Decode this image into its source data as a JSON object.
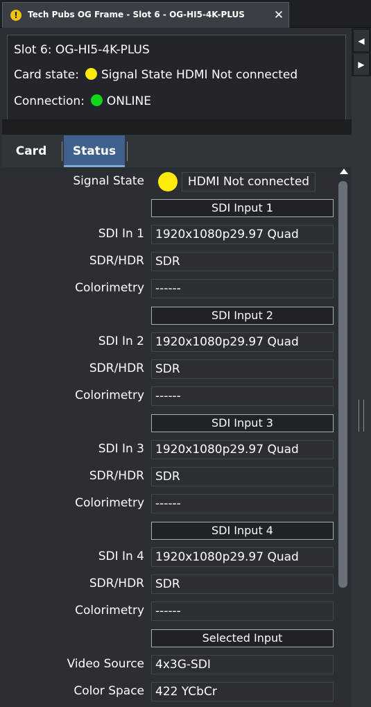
{
  "window": {
    "tab_title": "Tech Pubs OG Frame - Slot 6 - OG-HI5-4K-PLUS",
    "warn_icon_glyph": "!",
    "close_glyph": "✕"
  },
  "side": {
    "left_glyph": "◀",
    "right_glyph": "▶"
  },
  "info": {
    "title": "Slot 6: OG-HI5-4K-PLUS",
    "card_state_label": "Card state:",
    "card_state_value": "Signal State HDMI Not connected",
    "card_state_color": "#ffeb0a",
    "connection_label": "Connection:",
    "connection_value": "ONLINE",
    "connection_color": "#12d61a"
  },
  "tabs": [
    {
      "label": "Card",
      "active": false
    },
    {
      "label": "Status",
      "active": true
    }
  ],
  "status": {
    "signal_state": {
      "label": "Signal State",
      "value": "HDMI Not connected",
      "color": "#ffeb0a"
    },
    "sections": [
      {
        "header": "SDI Input 1",
        "rows": [
          {
            "label": "SDI In 1",
            "value": "1920x1080p29.97 Quad"
          },
          {
            "label": "SDR/HDR",
            "value": "SDR"
          },
          {
            "label": "Colorimetry",
            "value": "------"
          }
        ]
      },
      {
        "header": "SDI Input 2",
        "rows": [
          {
            "label": "SDI In 2",
            "value": "1920x1080p29.97 Quad"
          },
          {
            "label": "SDR/HDR",
            "value": "SDR"
          },
          {
            "label": "Colorimetry",
            "value": "------"
          }
        ]
      },
      {
        "header": "SDI Input 3",
        "rows": [
          {
            "label": "SDI In 3",
            "value": "1920x1080p29.97 Quad"
          },
          {
            "label": "SDR/HDR",
            "value": "SDR"
          },
          {
            "label": "Colorimetry",
            "value": "------"
          }
        ]
      },
      {
        "header": "SDI Input 4",
        "rows": [
          {
            "label": "SDI In 4",
            "value": "1920x1080p29.97 Quad"
          },
          {
            "label": "SDR/HDR",
            "value": "SDR"
          },
          {
            "label": "Colorimetry",
            "value": "------"
          }
        ]
      },
      {
        "header": "Selected Input",
        "rows": [
          {
            "label": "Video Source",
            "value": "4x3G-SDI"
          },
          {
            "label": "Color Space",
            "value": "422 YCbCr"
          }
        ]
      }
    ]
  }
}
